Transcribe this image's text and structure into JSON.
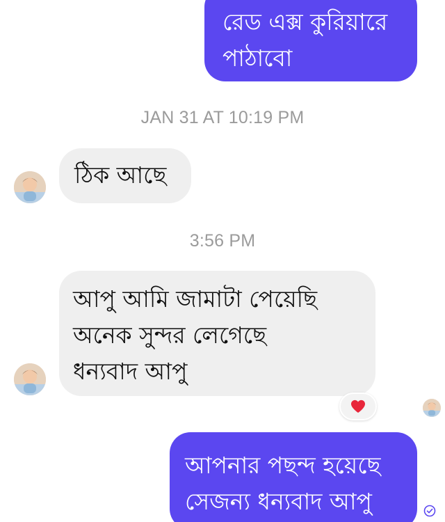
{
  "messages": [
    {
      "sender": "me",
      "text": "রেড এক্স কুরিয়ারে\nপাঠাবো"
    },
    {
      "sender": "other",
      "text": "ঠিক আছে"
    },
    {
      "sender": "other",
      "text": "আপু আমি জামাটা পেয়েছি\nঅনেক সুন্দর লেগেছে\nধন্যবাদ আপু",
      "reaction": "heart"
    },
    {
      "sender": "me",
      "text": "আপনার পছন্দ হয়েছে\nসেজন্য ধন্যবাদ আপু",
      "status": "sent"
    }
  ],
  "timestamps": [
    "JAN 31 AT 10:19 PM",
    "3:56 PM"
  ],
  "icons": {
    "reaction": "heart-icon",
    "read_receipt": "seen-avatar",
    "delivery": "check-circle-icon"
  },
  "colors": {
    "outgoing_bubble": "#5b47f0",
    "incoming_bubble": "#efefef",
    "timestamp_text": "#9b9b9b",
    "reaction_heart": "#e8263b"
  }
}
